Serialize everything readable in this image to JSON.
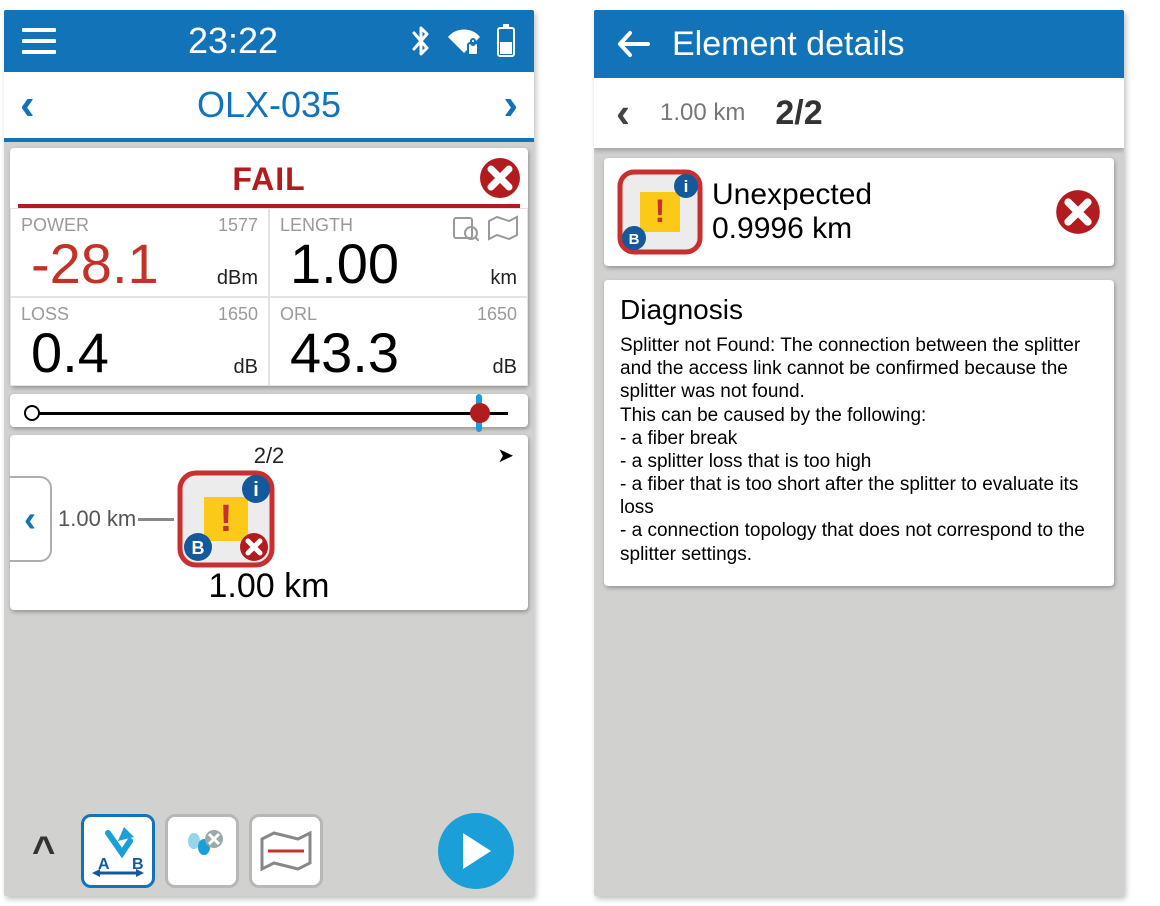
{
  "left": {
    "statusbar": {
      "time": "23:22"
    },
    "nav": {
      "title": "OLX-035"
    },
    "result": {
      "label": "FAIL"
    },
    "metrics": {
      "power": {
        "label": "POWER",
        "wavelength": "1577",
        "value": "-28.1",
        "unit": "dBm"
      },
      "length": {
        "label": "LENGTH",
        "value": "1.00",
        "unit": "km"
      },
      "loss": {
        "label": "LOSS",
        "wavelength": "1650",
        "value": "0.4",
        "unit": "dB"
      },
      "orl": {
        "label": "ORL",
        "wavelength": "1650",
        "value": "43.3",
        "unit": "dB"
      }
    },
    "map": {
      "count": "2/2",
      "segment_label": "1.00 km",
      "distance": "1.00 km"
    },
    "bottom": {
      "ab_label_a": "A",
      "ab_label_b": "B"
    }
  },
  "right": {
    "header": {
      "title": "Element details"
    },
    "sub": {
      "distance": "1.00 km",
      "count": "2/2"
    },
    "element": {
      "type": "Unexpected",
      "position": "0.9996 km"
    },
    "diagnosis": {
      "title": "Diagnosis",
      "body": "Splitter not Found: The connection between the splitter and the access link cannot be confirmed because the splitter was not found.\nThis can be caused by the following:\n- a fiber break\n- a splitter loss that is too high\n- a fiber that is too short after the splitter to evaluate its loss\n- a connection topology that does not correspond to the splitter settings."
    }
  }
}
